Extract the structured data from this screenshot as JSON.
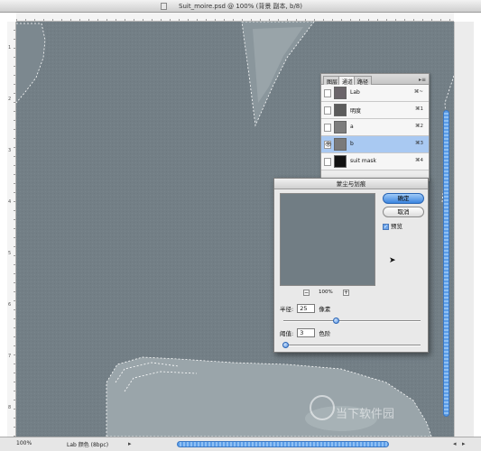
{
  "window": {
    "title": "Suit_moire.psd @ 100% (背景 副本, b/8)"
  },
  "rulers": {
    "left_ticks": [
      "1",
      "2",
      "3",
      "4",
      "5",
      "6",
      "7",
      "8"
    ]
  },
  "statusbar": {
    "zoom": "100%",
    "doc_info": "Lab 颜色 (8bpc)"
  },
  "channels_palette": {
    "tabs": [
      "图层",
      "通道",
      "路径"
    ],
    "active_tab": "通道",
    "channels": [
      {
        "name": "Lab",
        "key": "⌘~",
        "visible": false,
        "selected": false
      },
      {
        "name": "明度",
        "key": "⌘1",
        "visible": false,
        "selected": false
      },
      {
        "name": "a",
        "key": "⌘2",
        "visible": false,
        "selected": false
      },
      {
        "name": "b",
        "key": "⌘3",
        "visible": true,
        "selected": true
      },
      {
        "name": "suit mask",
        "key": "⌘4",
        "visible": false,
        "selected": false
      }
    ]
  },
  "dialog": {
    "title": "蒙尘与划痕",
    "ok_label": "确定",
    "cancel_label": "取消",
    "preview_label": "预览",
    "preview_checked": true,
    "zoom_level": "100%",
    "zoom_out": "−",
    "zoom_in": "+",
    "radius": {
      "label": "半径:",
      "value": "25",
      "unit": "像素",
      "slider_fraction": 0.38
    },
    "threshold": {
      "label": "阈值:",
      "value": "3",
      "unit": "色阶",
      "slider_fraction": 0.01
    }
  },
  "watermark": {
    "text": "当下软件园"
  },
  "colors": {
    "canvas": "#737f86",
    "selection_accent": "#3d86e0"
  }
}
